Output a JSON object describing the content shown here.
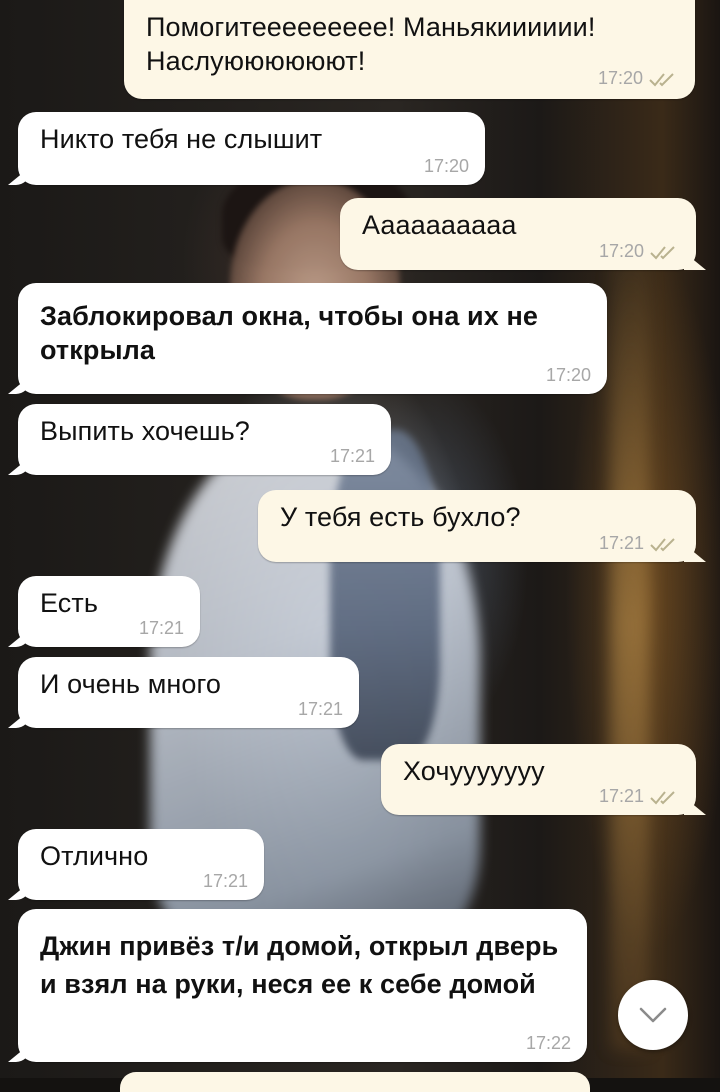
{
  "messages": [
    {
      "dir": "out",
      "text": "Помогитеееееееее! Маньякииииии! Наслуюююююют!",
      "time": "17:20",
      "read": true
    },
    {
      "dir": "in",
      "text": "Никто тебя не слышит",
      "time": "17:20"
    },
    {
      "dir": "out",
      "text": "Аааааааааа",
      "time": "17:20",
      "read": true
    },
    {
      "dir": "in",
      "text": "Заблокировал окна, чтобы она их не открыла",
      "time": "17:20",
      "bold": true
    },
    {
      "dir": "in",
      "text": "Выпить хочешь?",
      "time": "17:21"
    },
    {
      "dir": "out",
      "text": "У тебя есть бухло?",
      "time": "17:21",
      "read": true
    },
    {
      "dir": "in",
      "text": "Есть",
      "time": "17:21"
    },
    {
      "dir": "in",
      "text": "И очень много",
      "time": "17:21"
    },
    {
      "dir": "out",
      "text": "Хочууууууу",
      "time": "17:21",
      "read": true
    },
    {
      "dir": "in",
      "text": "Отлично",
      "time": "17:21"
    },
    {
      "dir": "in",
      "text": "Джин привёз т/и домой, открыл дверь и взял на руки, неся ее к себе домой",
      "time": "17:22",
      "bold": true
    }
  ],
  "icons": {
    "read_receipt": "double-check-icon",
    "scroll_down": "chevron-down-icon"
  },
  "colors": {
    "incoming_bubble": "#ffffff",
    "outgoing_bubble": "#fdf7e6",
    "timestamp": "#a7a7a7"
  }
}
